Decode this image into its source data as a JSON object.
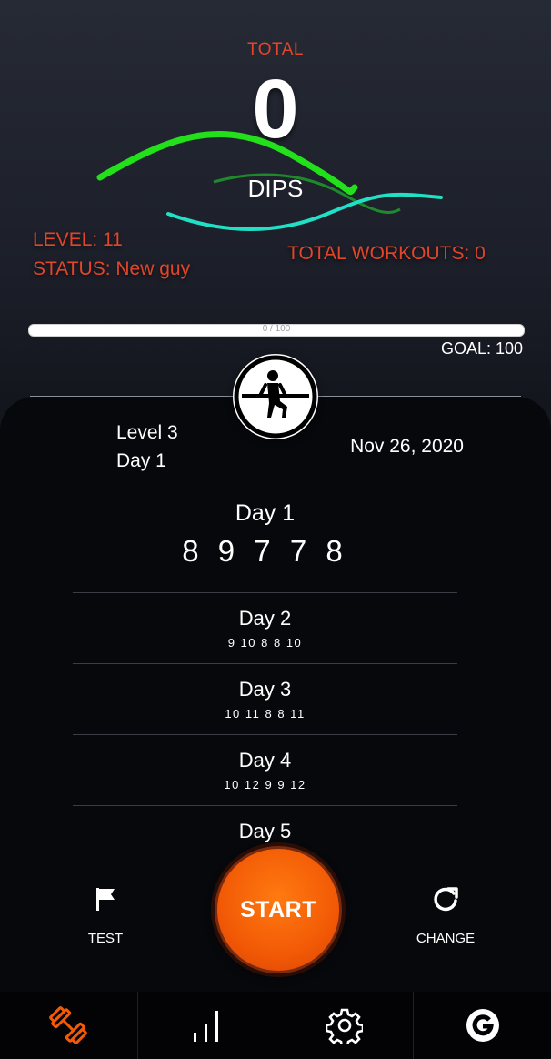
{
  "header": {
    "total_label": "TOTAL",
    "total_value": "0",
    "exercise": "DIPS",
    "level": "LEVEL: 11",
    "status": "STATUS: New guy",
    "total_workouts": "TOTAL WORKOUTS: 0"
  },
  "progress": {
    "text": "0 / 100",
    "value": 0,
    "max": 100,
    "goal": "GOAL: 100"
  },
  "plan": {
    "level": "Level 3",
    "day": "Day 1",
    "date": "Nov 26, 2020",
    "current": {
      "title": "Day 1",
      "reps": "8 9 7 7 8"
    },
    "days": [
      {
        "title": "Day 2",
        "reps": "9 10 8 8 10"
      },
      {
        "title": "Day 3",
        "reps": "10 11 8 8 11"
      },
      {
        "title": "Day 4",
        "reps": "10 12 9 9 12"
      },
      {
        "title": "Day 5",
        "reps": ""
      }
    ]
  },
  "actions": {
    "test_label": "TEST",
    "start_label": "START",
    "change_label": "CHANGE"
  },
  "nav": {
    "items": [
      "dumbbell-icon",
      "stats-bars-icon",
      "gear-icon",
      "g-logo-icon"
    ]
  },
  "colors": {
    "accent": "#e2452a",
    "start": "#f25a06",
    "wave_green": "#22e01a",
    "wave_cyan": "#21e0c6"
  }
}
